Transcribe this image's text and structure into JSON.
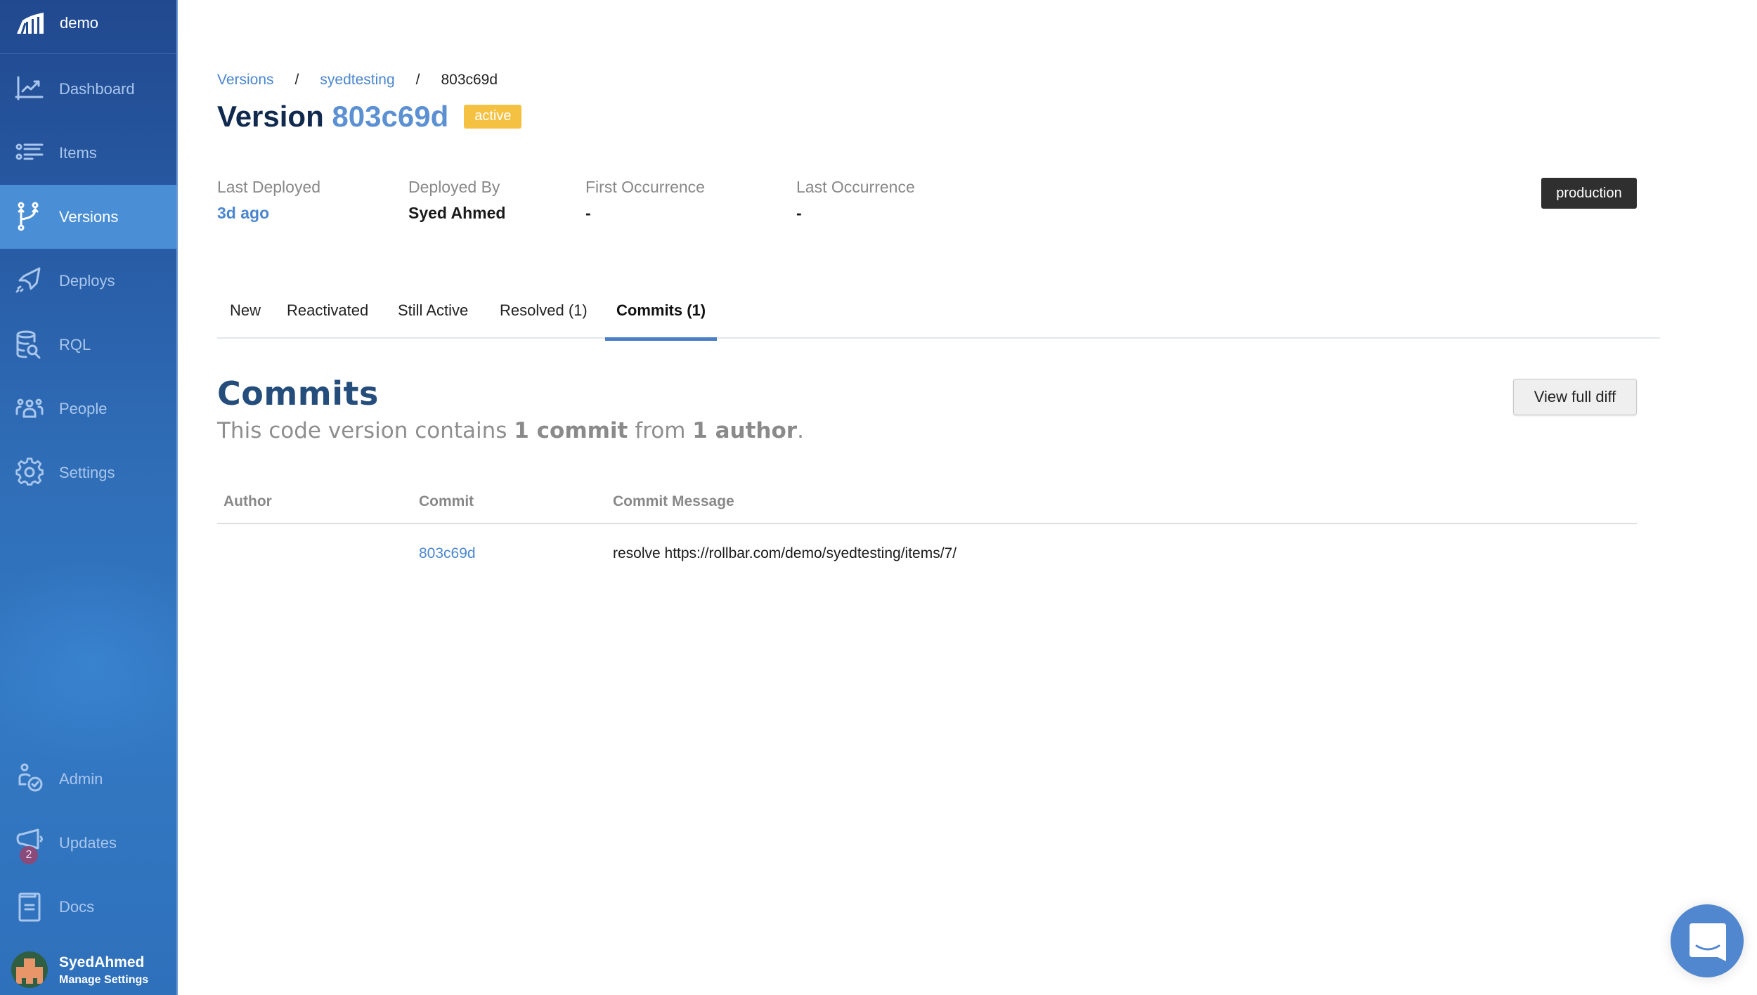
{
  "sidebar": {
    "org_name": "demo",
    "items": [
      {
        "label": "Dashboard",
        "icon": "chart-line-icon"
      },
      {
        "label": "Items",
        "icon": "list-icon"
      },
      {
        "label": "Versions",
        "icon": "git-branch-icon",
        "active": true
      },
      {
        "label": "Deploys",
        "icon": "rocket-icon"
      },
      {
        "label": "RQL",
        "icon": "database-search-icon"
      },
      {
        "label": "People",
        "icon": "people-icon"
      },
      {
        "label": "Settings",
        "icon": "gear-icon"
      }
    ],
    "bottom_items": [
      {
        "label": "Admin",
        "icon": "admin-user-check-icon"
      },
      {
        "label": "Updates",
        "icon": "megaphone-icon",
        "badge": "2"
      },
      {
        "label": "Docs",
        "icon": "book-icon"
      }
    ],
    "user": {
      "name": "SyedAhmed",
      "subtitle": "Manage Settings"
    }
  },
  "breadcrumb": [
    {
      "label": "Versions",
      "link": true
    },
    {
      "label": "syedtesting",
      "link": true
    },
    {
      "label": "803c69d",
      "link": false
    }
  ],
  "breadcrumb_separator": "/",
  "title": {
    "prefix": "Version",
    "hash": "803c69d",
    "status": "active"
  },
  "meta": [
    {
      "label": "Last Deployed",
      "value": "3d ago",
      "link": true
    },
    {
      "label": "Deployed By",
      "value": "Syed Ahmed",
      "link": false
    },
    {
      "label": "First Occurrence",
      "value": "-",
      "link": false
    },
    {
      "label": "Last Occurrence",
      "value": "-",
      "link": false
    }
  ],
  "environment": "production",
  "tabs": [
    {
      "label": "New"
    },
    {
      "label": "Reactivated"
    },
    {
      "label": "Still Active"
    },
    {
      "label": "Resolved (1)"
    },
    {
      "label": "Commits (1)",
      "active": true
    }
  ],
  "commits": {
    "heading": "Commits",
    "subtitle": {
      "part1": "This code version contains ",
      "commit_count": "1 commit",
      "part2": " from ",
      "author_count": "1 author",
      "part3": "."
    },
    "view_diff_label": "View full diff",
    "columns": [
      "Author",
      "Commit",
      "Commit Message"
    ],
    "rows": [
      {
        "author": "",
        "commit": "803c69d",
        "message": "resolve https://rollbar.com/demo/syedtesting/items/7/"
      }
    ]
  },
  "colors": {
    "accent": "#4a86cf",
    "sidebar_active": "#4a8fd6",
    "status_active": "#f5c143",
    "title_dark": "#10294f"
  }
}
